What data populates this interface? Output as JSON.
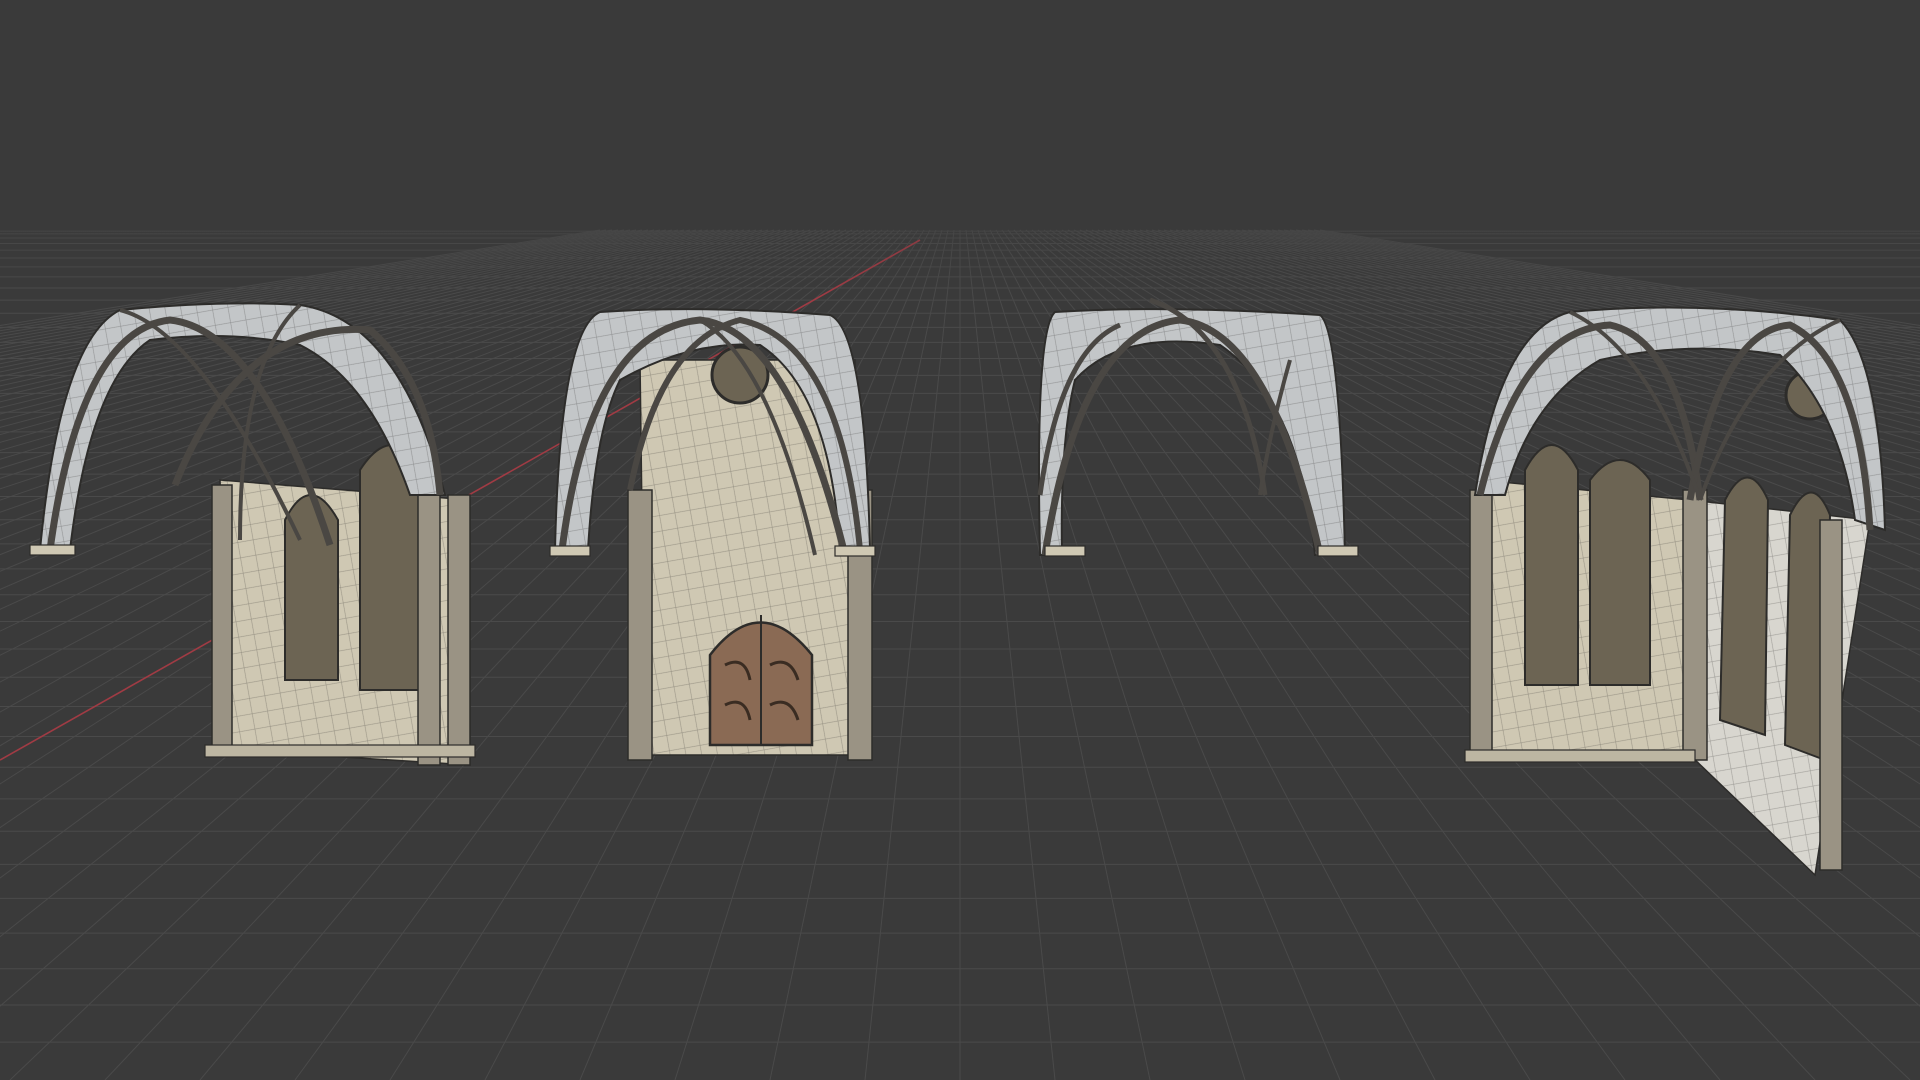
{
  "viewport": {
    "background": "#3a3a3a",
    "grid_color": "#4a4a4a",
    "x_axis_color": "#a03b44"
  },
  "models": [
    {
      "name": "vault-bay-with-windows"
    },
    {
      "name": "vault-bay-with-door"
    },
    {
      "name": "open-vault-bay"
    },
    {
      "name": "corner-vault-bay-with-windows"
    }
  ],
  "colors": {
    "stone": "#cfc8b3",
    "stone_dark": "#9a9384",
    "vault": "#c3c6c8",
    "rib": "#4a4743",
    "window_glass": "#6c6453",
    "door": "#8a6a54",
    "wire": "#2d2c2a"
  }
}
